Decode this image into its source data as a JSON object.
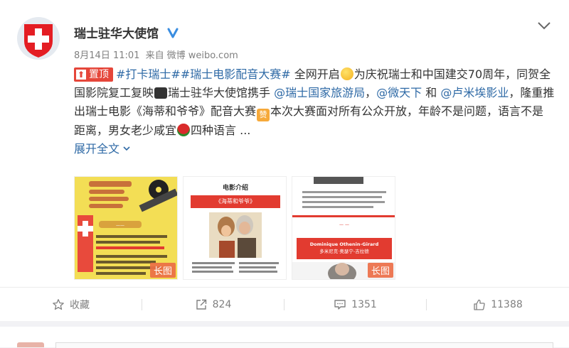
{
  "post": {
    "author": "瑞士驻华大使馆",
    "date": "8月14日 11:01",
    "source_prefix": "来自",
    "source": "微博 weibo.com",
    "pin_label": "置顶",
    "pin_icon": "pin-icon",
    "text": {
      "tag1": "#打卡瑞士#",
      "tag2": "#瑞士电影配音大赛#",
      "t1": "全网开启",
      "t2": "为庆祝瑞士和中国建交70周年，同贺全国影院复工复映",
      "t3": "瑞士驻华大使馆携手",
      "mention1": "@瑞士国家旅游局",
      "t4": "，",
      "mention2": "@微天下",
      "t5": "和",
      "mention3": "@卢米埃影业",
      "t6": "，隆重推出瑞士电影《海蒂和爷爷》配音大赛",
      "t7": "本次大赛面对所有公众开放，年龄不是问题，语言不是距离，男女老少咸宜",
      "t8": "四种语言 ...",
      "expand": "展开全文",
      "expand_icon": "chevron-down-small-icon"
    },
    "images": [
      {
        "badge": "长图"
      },
      {
        "title": "电影介绍",
        "banner": "《海蒂和爷爷》"
      },
      {
        "heading": "Dominique Othenin-Girard",
        "sub": "多米尼克·奥瑟宁-吉拉德",
        "badge": "长图"
      }
    ]
  },
  "actions": {
    "favorite": "收藏",
    "repost": "824",
    "comment": "1351",
    "like": "11388"
  },
  "colors": {
    "accent": "#2f6aa6",
    "brand_red": "#e5463a"
  }
}
